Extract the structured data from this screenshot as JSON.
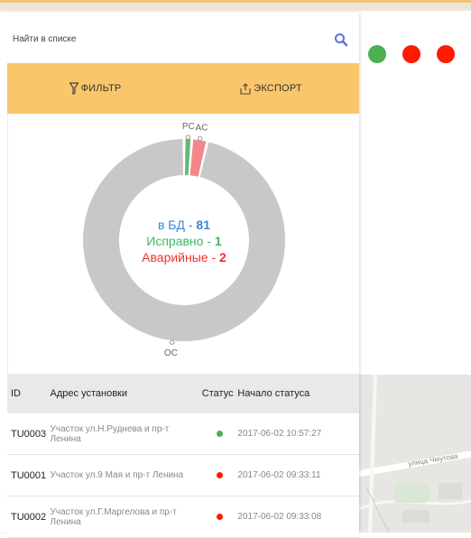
{
  "search": {
    "placeholder": "Найти в списке"
  },
  "toolbar": {
    "filter_label": "ФИЛЬТР",
    "export_label": "ЭКСПОРТ"
  },
  "status_dots": [
    {
      "color": "#4caf50"
    },
    {
      "color": "#ff1a00"
    },
    {
      "color": "#ff1a00"
    }
  ],
  "chart_data": {
    "type": "pie",
    "donut": true,
    "slices": [
      {
        "label": "PC",
        "value": 1,
        "color": "#5fb878"
      },
      {
        "label": "AC",
        "value": 2,
        "color": "#f3868a"
      },
      {
        "label": "OC",
        "value": 78,
        "color": "#c8c8c8"
      }
    ],
    "center": {
      "line1_prefix": "в БД - ",
      "line1_value": "81",
      "line2_prefix": "Исправно - ",
      "line2_value": "1",
      "line3_prefix": "Аварийные - ",
      "line3_value": "2"
    }
  },
  "table": {
    "headers": {
      "id": "ID",
      "address": "Адрес установки",
      "status": "Статус",
      "start": "Начало статуса"
    },
    "rows": [
      {
        "id": "TU0003",
        "address": "Участок ул.Н.Руднева и пр-т Ленина",
        "status_color": "#4caf50",
        "start": "2017-06-02 10:57:27"
      },
      {
        "id": "TU0001",
        "address": "Участок ул.9 Мая и пр-т Ленина",
        "status_color": "#ff1a00",
        "start": "2017-06-02 09:33:11"
      },
      {
        "id": "TU0002",
        "address": "Участок ул.Г.Маргелова и пр-т Ленина",
        "status_color": "#ff1a00",
        "start": "2017-06-02 09:33:08"
      }
    ]
  },
  "map": {
    "street_label": "улица Чмутова"
  }
}
